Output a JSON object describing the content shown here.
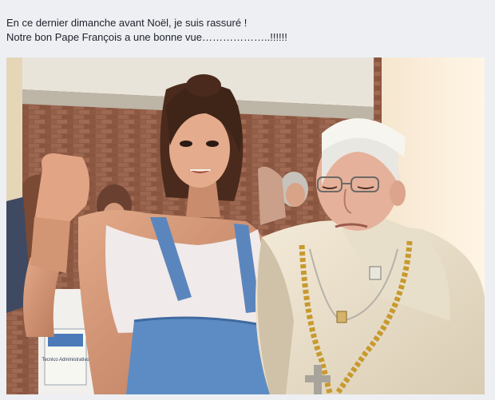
{
  "post": {
    "caption_line_1": "En ce dernier dimanche avant Noël, je suis rassuré !",
    "caption_line_2": "Notre bon Pape François a une bonne vue………………..!!!!!!"
  },
  "photo": {
    "badge_text": "Tecnico Administrativo"
  }
}
